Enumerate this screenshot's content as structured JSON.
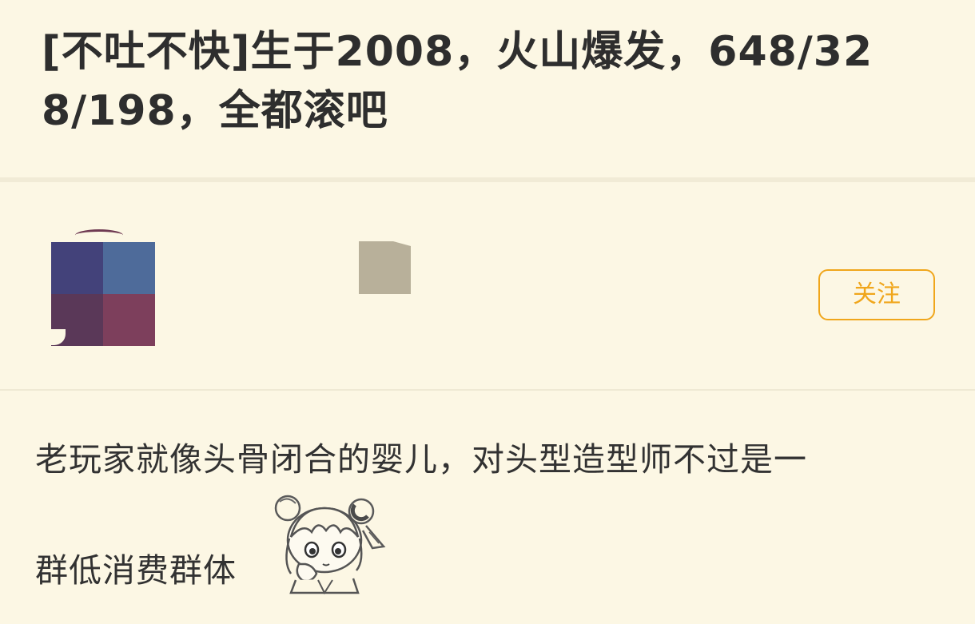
{
  "post": {
    "title": "[不吐不快]生于2008，火山爆发，648/328/198，全都滚吧"
  },
  "author": {
    "follow_label": "关注"
  },
  "content": {
    "line1": "老玩家就像头骨闭合的婴儿，对头型造型师不过是一",
    "line2": "群低消费群体",
    "sticker_icon": "chibi-girl-thinking-sticker"
  },
  "colors": {
    "background": "#fcf7e4",
    "accent": "#f0a61b",
    "title_text": "#2e2e2e"
  }
}
